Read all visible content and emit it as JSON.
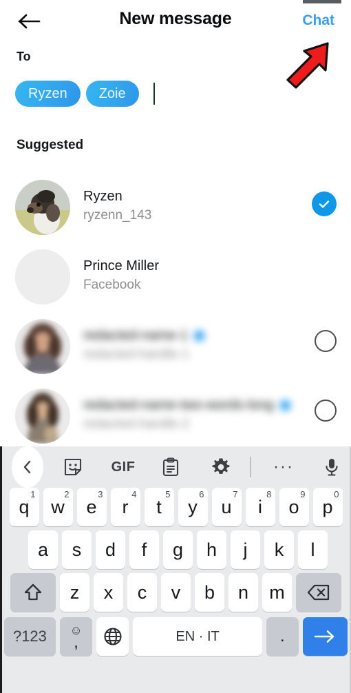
{
  "header": {
    "back_icon": "back-arrow-icon",
    "title": "New message",
    "action_label": "Chat",
    "action_color": "#3a9ef0"
  },
  "compose": {
    "to_label": "To",
    "recipient_chips": [
      {
        "label": "Ryzen"
      },
      {
        "label": "Zoie"
      }
    ],
    "caret_visible": true
  },
  "suggested": {
    "section_label": "Suggested",
    "rows": [
      {
        "name": "Ryzen",
        "subtitle": "ryzenn_143",
        "avatar": "dog-photo-avatar",
        "verified": false,
        "selected": true,
        "selector": "check-filled",
        "blurred": false
      },
      {
        "name": "Prince Miller",
        "subtitle": "Facebook",
        "avatar": "placeholder-avatar",
        "verified": false,
        "selected": false,
        "selector": "none",
        "blurred": false
      },
      {
        "name": "redacted-name-1",
        "subtitle": "redacted-handle-1",
        "avatar": "person-photo-avatar",
        "verified": true,
        "selected": false,
        "selector": "radio-empty",
        "blurred": true
      },
      {
        "name": "redacted-name-two-words-long",
        "subtitle": "redacted-handle-2",
        "avatar": "person-photo-avatar",
        "verified": true,
        "selected": false,
        "selector": "radio-empty",
        "blurred": true
      }
    ]
  },
  "annotation": {
    "type": "red-arrow",
    "color": "#ee1c1c",
    "points_to": "Chat"
  },
  "keyboard": {
    "toolbar": [
      {
        "name": "collapse-toolbar-icon",
        "glyph": "chevron-left-icon"
      },
      {
        "name": "sticker-icon",
        "glyph": "sticker-icon"
      },
      {
        "name": "gif-icon",
        "glyph": "GIF"
      },
      {
        "name": "clipboard-icon",
        "glyph": "clipboard-icon"
      },
      {
        "name": "settings-gear-icon",
        "glyph": "gear-icon"
      },
      {
        "name": "more-options-icon",
        "glyph": "···"
      },
      {
        "name": "microphone-icon",
        "glyph": "microphone-icon"
      }
    ],
    "row1": [
      {
        "key": "q",
        "num": "1"
      },
      {
        "key": "w",
        "num": "2"
      },
      {
        "key": "e",
        "num": "3"
      },
      {
        "key": "r",
        "num": "4"
      },
      {
        "key": "t",
        "num": "5"
      },
      {
        "key": "y",
        "num": "6"
      },
      {
        "key": "u",
        "num": "7"
      },
      {
        "key": "i",
        "num": "8"
      },
      {
        "key": "o",
        "num": "9"
      },
      {
        "key": "p",
        "num": "0"
      }
    ],
    "row2": [
      {
        "key": "a"
      },
      {
        "key": "s"
      },
      {
        "key": "d"
      },
      {
        "key": "f"
      },
      {
        "key": "g"
      },
      {
        "key": "h"
      },
      {
        "key": "j"
      },
      {
        "key": "k"
      },
      {
        "key": "l"
      }
    ],
    "row3": [
      {
        "key": "z"
      },
      {
        "key": "x"
      },
      {
        "key": "c"
      },
      {
        "key": "v"
      },
      {
        "key": "b"
      },
      {
        "key": "n"
      },
      {
        "key": "m"
      }
    ],
    "shift_label": "shift-icon",
    "backspace_label": "backspace-icon",
    "symbols_label": "?123",
    "emoji_label": "☺",
    "comma_label": ",",
    "globe_label": "globe-icon",
    "space_label": "EN · IT",
    "period_label": ".",
    "enter_label": "arrow-right-icon",
    "enter_color": "#2f80e8"
  }
}
